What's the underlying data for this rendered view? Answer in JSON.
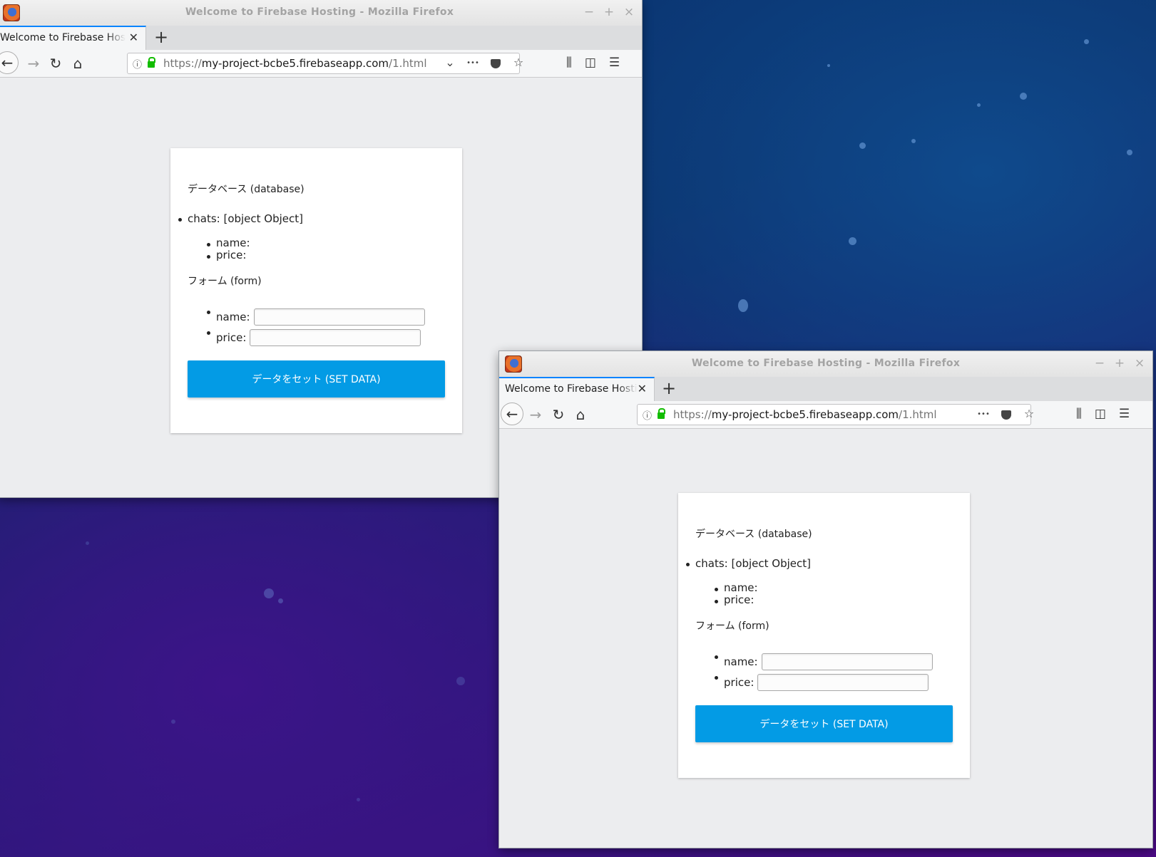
{
  "windows": [
    {
      "title": "Welcome to Firebase Hosting - Mozilla Firefox",
      "tab_label": "Welcome to Firebase Hosting",
      "url": {
        "scheme": "https://",
        "host": "my-project-bcbe5.firebaseapp.com",
        "path": "/1.html"
      },
      "page": {
        "database_title": "データベース (database)",
        "chats_item": "chats: [object Object]",
        "name_item": "name:",
        "price_item": "price:",
        "form_title": "フォーム (form)",
        "form_name_label": "name:",
        "form_price_label": "price:",
        "form_name_value": "",
        "form_price_value": "",
        "set_button": "データをセット (SET DATA)"
      }
    },
    {
      "title": "Welcome to Firebase Hosting - Mozilla Firefox",
      "tab_label": "Welcome to Firebase Hosting",
      "url": {
        "scheme": "https://",
        "host": "my-project-bcbe5.firebaseapp.com",
        "path": "/1.html"
      },
      "page": {
        "database_title": "データベース (database)",
        "chats_item": "chats: [object Object]",
        "name_item": "name:",
        "price_item": "price:",
        "form_title": "フォーム (form)",
        "form_name_label": "name:",
        "form_price_label": "price:",
        "form_name_value": "",
        "form_price_value": "",
        "set_button": "データをセット (SET DATA)"
      }
    }
  ],
  "icons": {
    "minimize": "−",
    "maximize": "+",
    "close": "×",
    "tab_close": "✕",
    "new_tab": "+",
    "back": "←",
    "forward": "→",
    "reload": "↻",
    "home": "⌂",
    "info": "ⓘ",
    "dropdown": "⌄",
    "more": "•••",
    "bookmark": "☆",
    "library": "⫼",
    "sidebar": "◫",
    "menu": "☰"
  },
  "colors": {
    "set_button_bg": "#039be5",
    "tab_accent": "#0a84ff",
    "lock": "#12bc00"
  }
}
